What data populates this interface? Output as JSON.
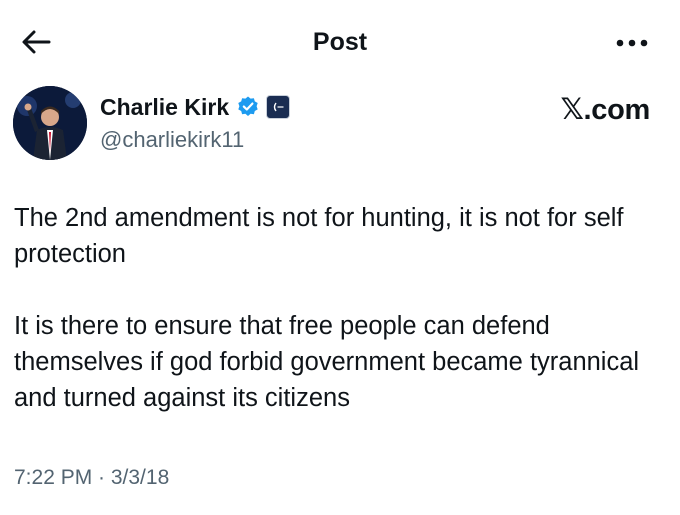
{
  "header": {
    "title": "Post",
    "back_icon": "arrow-left-icon",
    "more_icon": "more-horizontal-icon"
  },
  "author": {
    "name": "Charlie Kirk",
    "handle": "@charliekirk11",
    "verified_icon": "verified-badge-icon",
    "verified_color": "#1d9bf0"
  },
  "watermark": "𝕏.com",
  "post": {
    "text": "The 2nd amendment is not for hunting, it is not for self protection\n\nIt is there to ensure that free people can defend themselves if god forbid government became tyrannical and turned against its citizens",
    "timestamp": "7:22 PM · 3/3/18"
  }
}
